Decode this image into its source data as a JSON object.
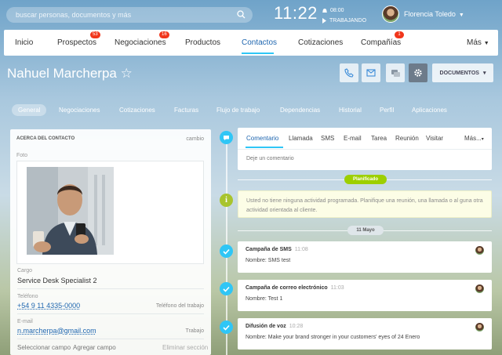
{
  "topbar": {
    "search_placeholder": "buscar personas, documentos y más",
    "clock": "11:22",
    "alarm": "08:00",
    "status": "TRABAJANDO",
    "user_name": "Florencia Toledo"
  },
  "nav": {
    "items": [
      {
        "label": "Inicio"
      },
      {
        "label": "Prospectos",
        "badge": "53"
      },
      {
        "label": "Negociaciones",
        "badge": "16"
      },
      {
        "label": "Productos"
      },
      {
        "label": "Contactos"
      },
      {
        "label": "Cotizaciones"
      },
      {
        "label": "Compañías",
        "badge": "1"
      },
      {
        "label": "Más"
      }
    ]
  },
  "header": {
    "title": "Nahuel Marcherpa",
    "star": "☆",
    "documents_label": "DOCUMENTOS"
  },
  "tabs": [
    "General",
    "Negociaciones",
    "Cotizaciones",
    "Facturas",
    "Flujo de trabajo",
    "Dependencias",
    "Historial",
    "Perfil",
    "Aplicaciones"
  ],
  "contact_panel": {
    "heading": "ACERCA DEL CONTACTO",
    "change": "cambio",
    "photo_label": "Foto",
    "job_label": "Cargo",
    "job_value": "Service Desk Specialist 2",
    "phone_label": "Teléfono",
    "phone_value": "+54 9 11 4335-0000",
    "phone_type": "Teléfono del trabajo",
    "email_label": "E-mail",
    "email_value": "n.marcherpa@gmail.com",
    "email_type": "Trabajo",
    "select_field": "Seleccionar campo",
    "add_field": "Agregar campo",
    "remove_section": "Eliminar sección"
  },
  "editor": {
    "tabs": [
      "Comentario",
      "Llamada",
      "SMS",
      "E-mail",
      "Tarea",
      "Reunión",
      "Visitar",
      "Más..."
    ],
    "placeholder": "Deje un comentario"
  },
  "timeline": {
    "planned_label": "Planificado",
    "planned_text": "Usted no tiene ninguna actividad programada. Planifique una reunión, una llamada o al guna otra actividad orientada al cliente.",
    "date_label": "11 Mayo",
    "items": [
      {
        "title": "Campaña de SMS",
        "time": "11:08",
        "body": "Nombre: SMS test"
      },
      {
        "title": "Campaña de correo electrónico",
        "time": "11:03",
        "body": "Nombre: Test 1"
      },
      {
        "title": "Difusión de voz",
        "time": "10:28",
        "body": "Nombre: Make your brand stronger in your customers' eyes of 24 Enero"
      }
    ]
  },
  "colors": {
    "accent": "#2fc6f6",
    "link": "#2067b0",
    "badge": "#f1361b",
    "planned": "#9dcf00",
    "check": "#2fc6f6"
  }
}
